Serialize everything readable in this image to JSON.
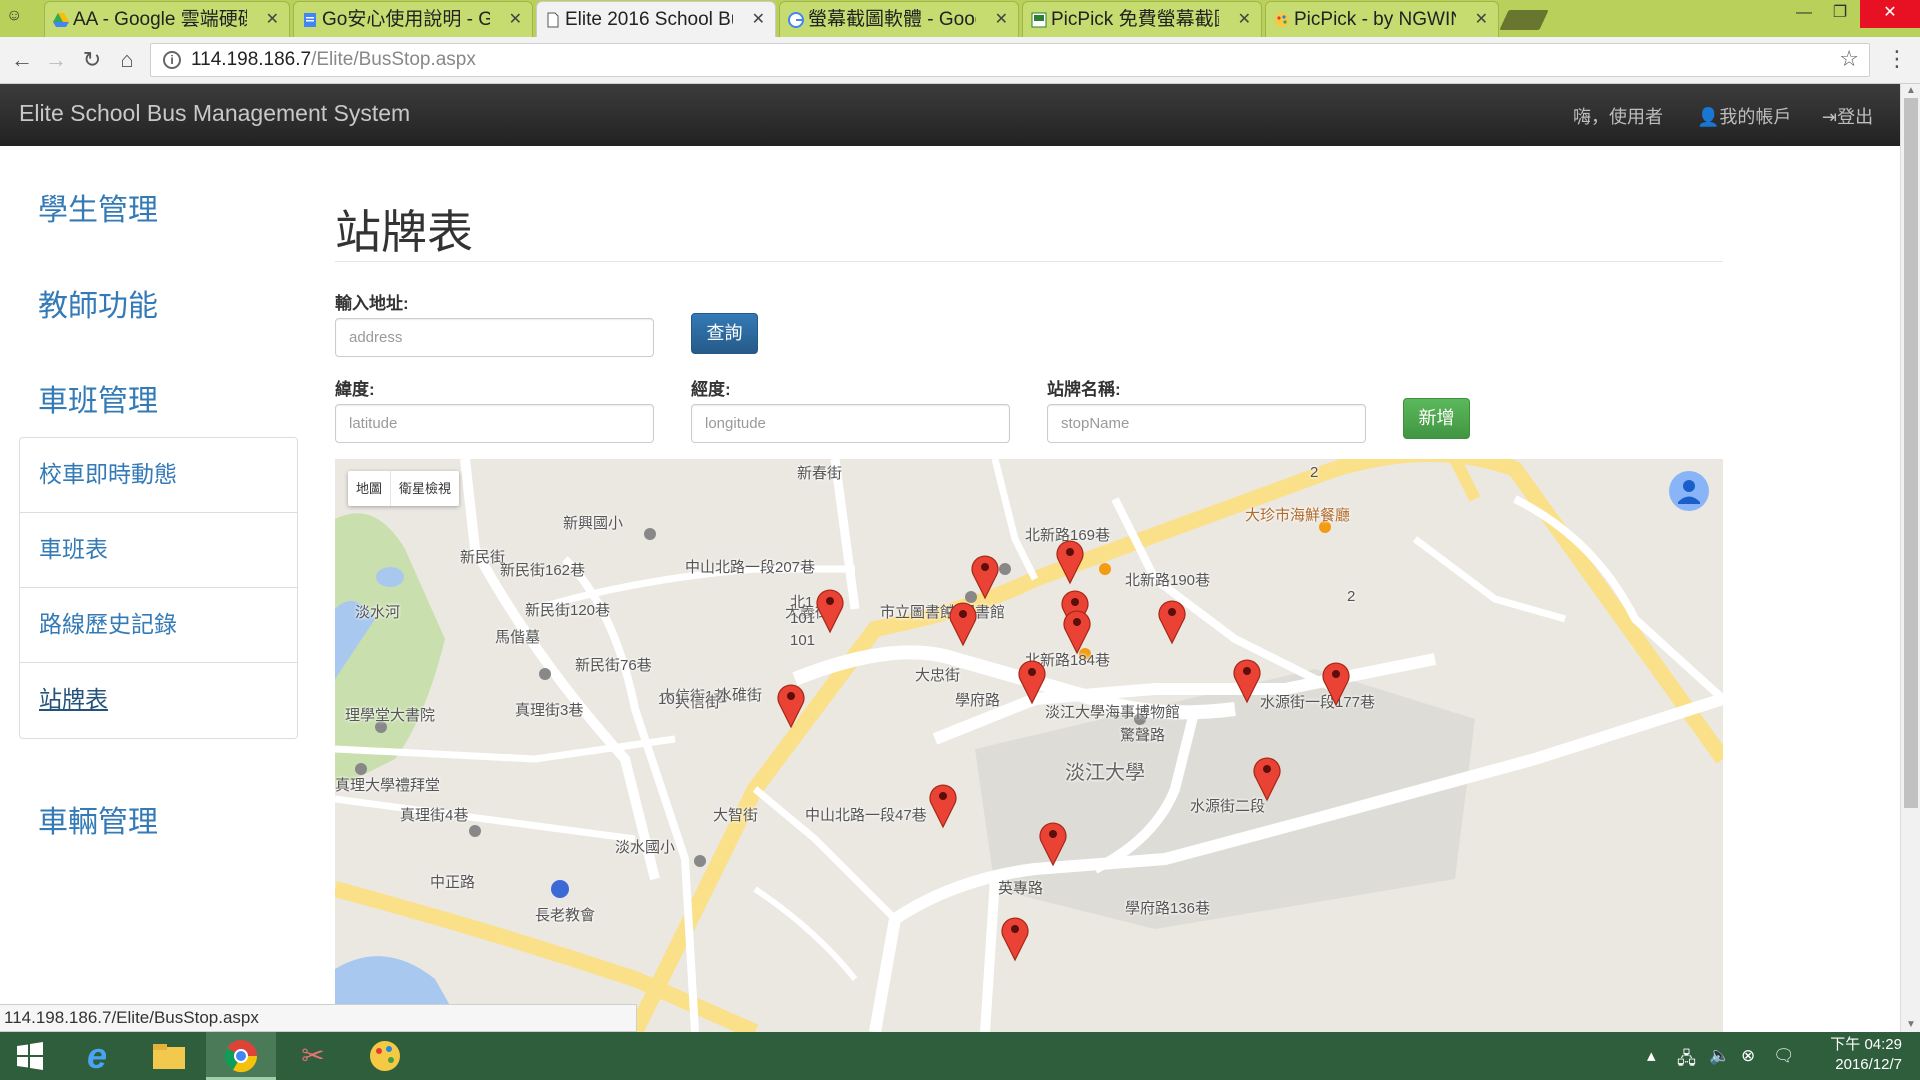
{
  "browser": {
    "tabs": [
      {
        "title": "AA - Google 雲端硬碟",
        "icon": "google-drive-icon"
      },
      {
        "title": "Go安心使用說明 - Google",
        "icon": "google-docs-icon"
      },
      {
        "title": "Elite 2016 School Bus",
        "icon": "page-icon",
        "active": true
      },
      {
        "title": "螢幕截圖軟體 - Google",
        "icon": "google-search-icon"
      },
      {
        "title": "PicPick 免費螢幕截圖",
        "icon": "picpick-page-icon"
      },
      {
        "title": "PicPick - by NGWIN",
        "icon": "picpick-logo-icon"
      }
    ],
    "url_host": "114.198.186.7",
    "url_path": "/Elite/BusStop.aspx",
    "status_url": "114.198.186.7/Elite/BusStop.aspx"
  },
  "navbar": {
    "brand": "Elite School Bus Management System",
    "greeting": "嗨，使用者",
    "account": "我的帳戶",
    "logout": "登出"
  },
  "sidebar": {
    "headings": [
      "學生管理",
      "教師功能",
      "車班管理",
      "車輛管理"
    ],
    "items": [
      {
        "label": "校車即時動態"
      },
      {
        "label": "車班表"
      },
      {
        "label": "路線歷史記錄"
      },
      {
        "label": "站牌表",
        "current": true
      }
    ]
  },
  "page": {
    "title": "站牌表",
    "address_label": "輸入地址:",
    "address_placeholder": "address",
    "search_button": "查詢",
    "lat_label": "緯度:",
    "lat_placeholder": "latitude",
    "lng_label": "經度:",
    "lng_placeholder": "longitude",
    "stop_label": "站牌名稱:",
    "stop_placeholder": "stopName",
    "add_button": "新增"
  },
  "map": {
    "type_map": "地圖",
    "type_satellite": "衛星檢視",
    "labels": [
      "新春街",
      "新興國小",
      "中山北路一段207巷",
      "大義街",
      "北1",
      "101",
      "馬偕墓",
      "大信街1巷",
      "大信街",
      "水碓街",
      "理學堂大書院",
      "真理大學禮拜堂",
      "真理街4巷",
      "淡水國小",
      "大智街",
      "大忠街",
      "市立圖書館",
      "中國書館",
      "北新路184巷",
      "北新路169巷",
      "北新路190巷",
      "淡江大學海事博物館",
      "學府路",
      "淡江大學",
      "驚聲路",
      "水源街二段",
      "水源街一段177巷",
      "英專路",
      "學府路136巷",
      "大珍市海鮮餐廳",
      "淡水河",
      "新民街",
      "中正路",
      "長老教會",
      "新民街162巷",
      "新民街120巷",
      "新民街76巷",
      "真理街3巷",
      "中山北路一段47巷",
      "101",
      "101",
      "2",
      "2"
    ]
  },
  "taskbar": {
    "time": "下午 04:29",
    "date": "2016/12/7"
  }
}
